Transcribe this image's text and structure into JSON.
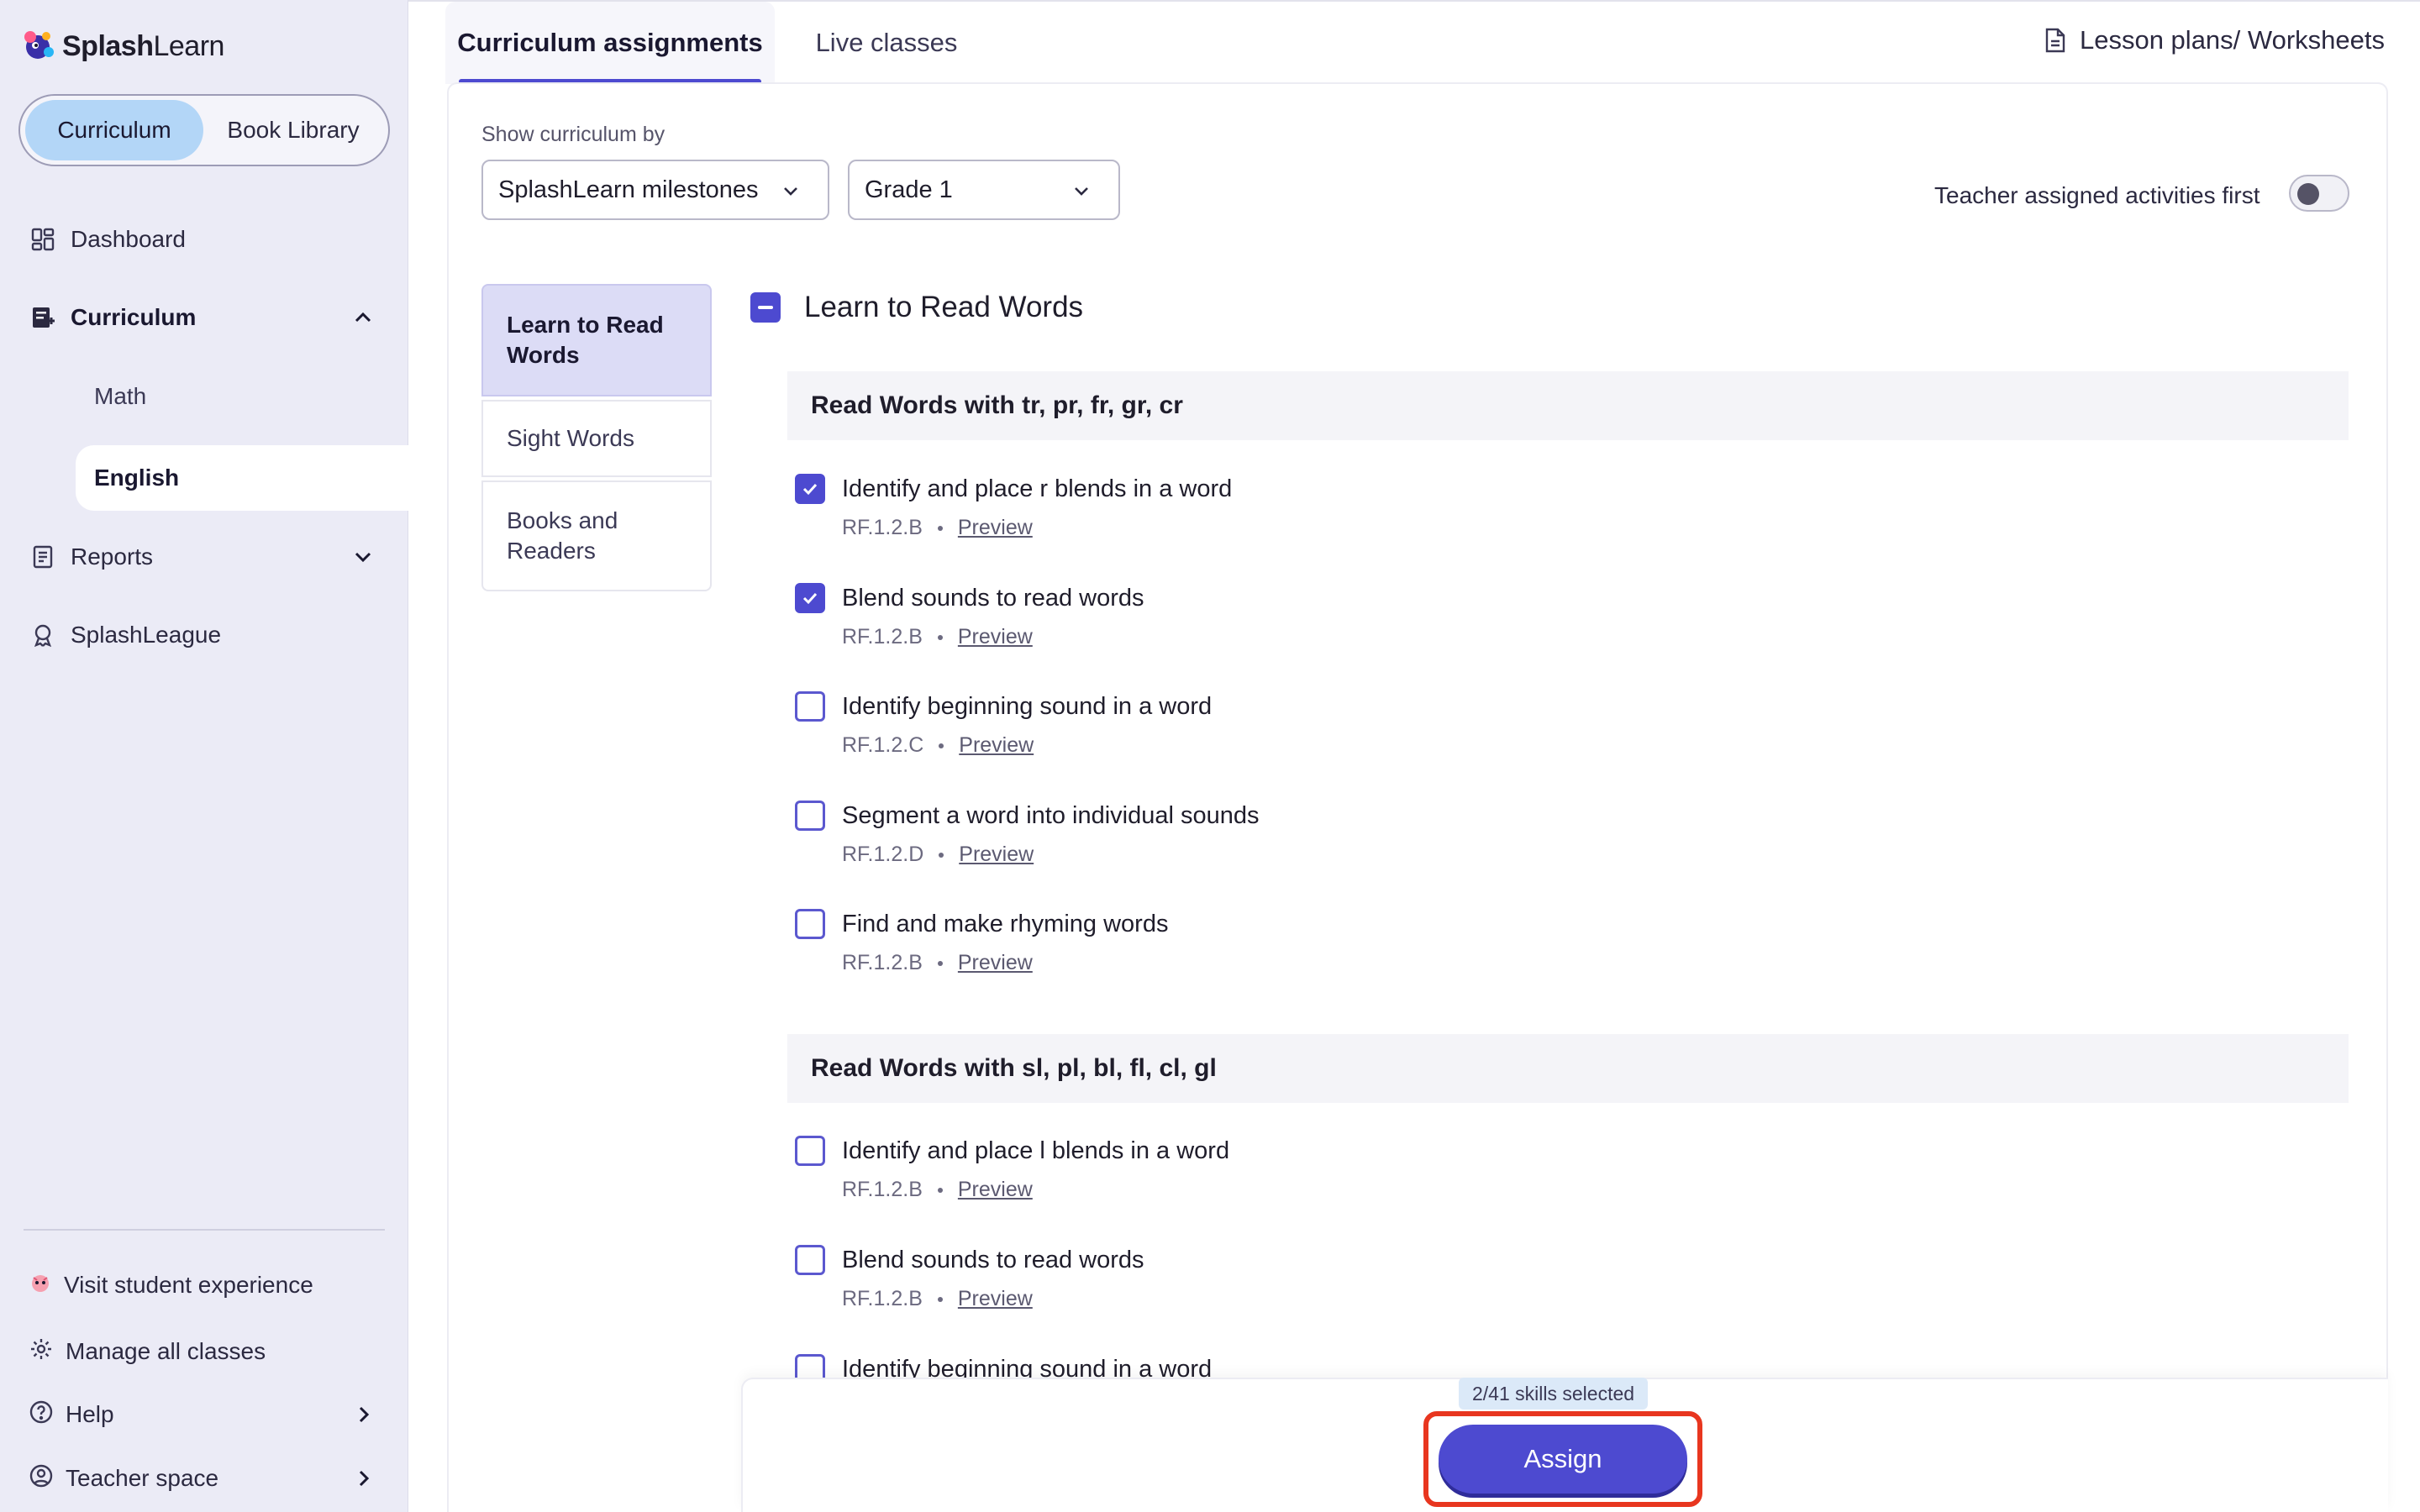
{
  "app": {
    "logo_bold": "Splash",
    "logo_light": "Learn"
  },
  "sidebar": {
    "segment": {
      "curriculum": "Curriculum",
      "book_library": "Book Library"
    },
    "nav": {
      "dashboard": "Dashboard",
      "curriculum": "Curriculum",
      "math": "Math",
      "english": "English",
      "reports": "Reports",
      "splashleague": "SplashLeague"
    },
    "footer": {
      "visit": "Visit student experience",
      "manage": "Manage all classes",
      "help": "Help",
      "teacher_space": "Teacher space"
    }
  },
  "tabs": {
    "curriculum_assignments": "Curriculum assignments",
    "live_classes": "Live classes",
    "lesson_plans": "Lesson plans/ Worksheets"
  },
  "filters": {
    "show_label": "Show curriculum by",
    "curriculum_select": "SplashLearn milestones",
    "grade_select": "Grade 1",
    "toggle_label": "Teacher assigned activities first",
    "toggle_on": false
  },
  "categories": [
    {
      "label": "Learn to Read Words",
      "active": true
    },
    {
      "label": "Sight Words",
      "active": false
    },
    {
      "label": "Books and Readers",
      "active": false
    }
  ],
  "group": {
    "title": "Learn to Read Words",
    "preview_label": "Preview",
    "sections": [
      {
        "title": "Read Words with tr, pr, fr, gr, cr",
        "skills": [
          {
            "name": "Identify and place r blends in a word",
            "code": "RF.1.2.B",
            "checked": true
          },
          {
            "name": "Blend sounds to read words",
            "code": "RF.1.2.B",
            "checked": true
          },
          {
            "name": "Identify beginning sound in a word",
            "code": "RF.1.2.C",
            "checked": false
          },
          {
            "name": "Segment a word into individual sounds",
            "code": "RF.1.2.D",
            "checked": false
          },
          {
            "name": "Find and make rhyming words",
            "code": "RF.1.2.B",
            "checked": false
          }
        ]
      },
      {
        "title": "Read Words with sl, pl, bl, fl, cl, gl",
        "skills": [
          {
            "name": "Identify and place l blends in a word",
            "code": "RF.1.2.B",
            "checked": false
          },
          {
            "name": "Blend sounds to read words",
            "code": "RF.1.2.B",
            "checked": false
          },
          {
            "name": "Identify beginning sound in a word",
            "code": "",
            "checked": false
          }
        ]
      }
    ]
  },
  "footer_bar": {
    "skills_selected": "2/41 skills selected",
    "assign_label": "Assign"
  },
  "colors": {
    "accent": "#4d4ad0",
    "sidebar_bg": "#ebebf6",
    "segment_active": "#b3d6f7",
    "highlight": "#e8361f"
  }
}
